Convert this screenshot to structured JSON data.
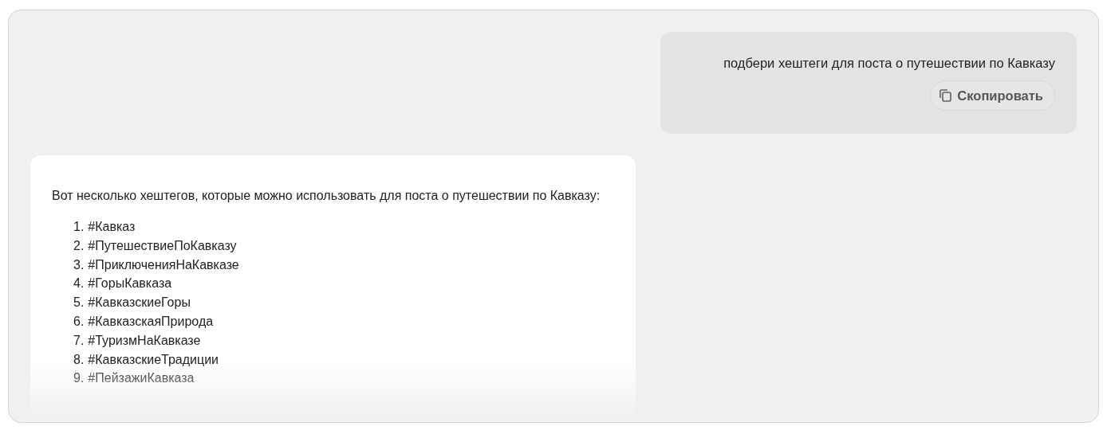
{
  "user_message": {
    "text": "подбери хештеги для поста о путешествии по Кавказу",
    "copy_button": "Скопировать"
  },
  "response": {
    "intro": "Вот несколько хештегов, которые можно использовать для поста о путешествии по Кавказу:",
    "items": [
      {
        "number": "1.",
        "text": "#Кавказ"
      },
      {
        "number": "2.",
        "text": "#ПутешествиеПоКавказу"
      },
      {
        "number": "3.",
        "text": "#ПриключенияНаКавказе"
      },
      {
        "number": "4.",
        "text": "#ГорыКавказа"
      },
      {
        "number": "5.",
        "text": "#КавказскиеГоры"
      },
      {
        "number": "6.",
        "text": "#КавказскаяПрирода"
      },
      {
        "number": "7.",
        "text": "#ТуризмНаКавказе"
      },
      {
        "number": "8.",
        "text": "#КавказскиеТрадиции"
      },
      {
        "number": "9.",
        "text": "#ПейзажиКавказа"
      }
    ]
  }
}
